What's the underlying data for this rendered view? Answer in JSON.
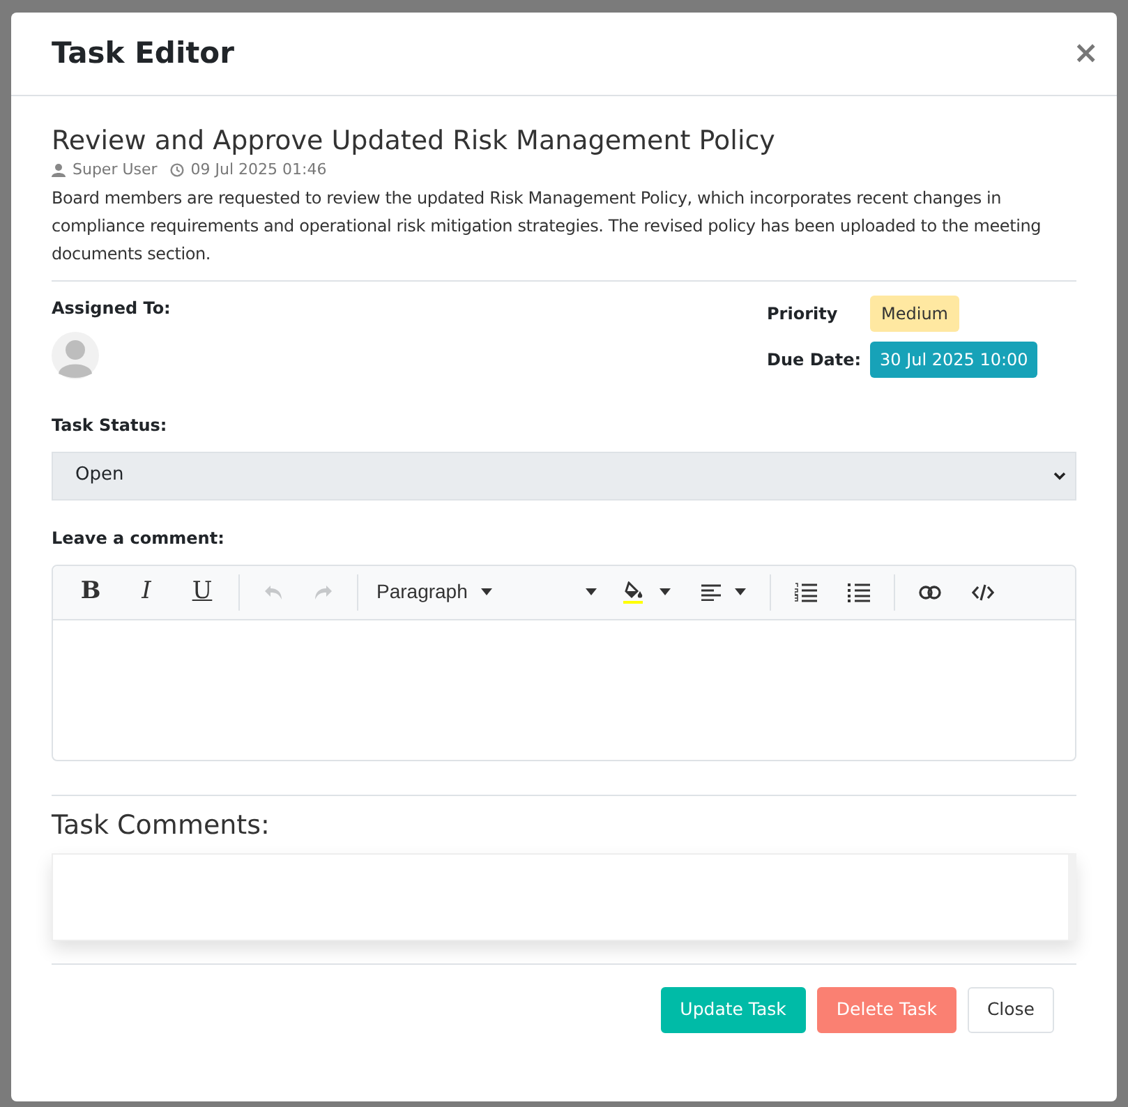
{
  "dialog": {
    "title": "Task Editor",
    "close": "×"
  },
  "task": {
    "title": "Review and Approve Updated Risk Management Policy",
    "author": "Super User",
    "created": "09 Jul 2025 01:46",
    "description": "Board members are requested to review the updated Risk Management Policy, which incorporates recent changes in compliance requirements and operational risk mitigation strategies. The revised policy has been uploaded to the meeting documents section."
  },
  "assigned_to": {
    "label": "Assigned To:"
  },
  "priority": {
    "label": "Priority",
    "value": "Medium"
  },
  "due_date": {
    "label": "Due Date:",
    "value": "30 Jul 2025 10:00"
  },
  "status": {
    "label": "Task Status:",
    "value": "Open"
  },
  "comment": {
    "label": "Leave a comment:",
    "toolbar": [
      [
        {
          "kind": "bold",
          "label": "B",
          "disabled": false
        },
        {
          "kind": "italic",
          "label": "I",
          "disabled": false
        },
        {
          "kind": "underline",
          "label": "U",
          "disabled": false
        }
      ],
      [
        {
          "kind": "undo",
          "disabled": true
        },
        {
          "kind": "redo",
          "disabled": true
        }
      ],
      [
        {
          "kind": "paragraph",
          "label": "Paragraph",
          "disabled": false
        },
        {
          "kind": "font",
          "disabled": false
        },
        {
          "kind": "highlight",
          "color": "#ffff00",
          "disabled": false
        },
        {
          "kind": "align",
          "disabled": false
        }
      ],
      [
        {
          "kind": "ordered_list",
          "disabled": false
        },
        {
          "kind": "unordered_list",
          "disabled": false
        }
      ],
      [
        {
          "kind": "link",
          "disabled": false
        },
        {
          "kind": "code",
          "disabled": false
        }
      ]
    ]
  },
  "comments": {
    "heading": "Task Comments:"
  },
  "buttons": [
    {
      "label": "Update Task",
      "kind": "primary"
    },
    {
      "label": "Delete Task",
      "kind": "danger"
    },
    {
      "label": "Close",
      "kind": "default"
    }
  ]
}
